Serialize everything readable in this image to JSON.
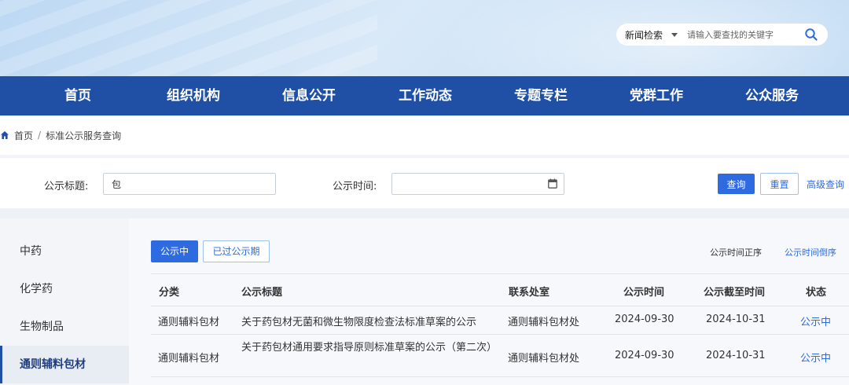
{
  "header": {
    "search": {
      "category": "新闻检索",
      "placeholder": "请输入要查找的关键字"
    }
  },
  "nav": {
    "items": [
      "首页",
      "组织机构",
      "信息公开",
      "工作动态",
      "专题专栏",
      "党群工作",
      "公众服务"
    ]
  },
  "breadcrumb": {
    "home": "首页",
    "separator": "/",
    "current": "标准公示服务查询"
  },
  "filter": {
    "title_label": "公示标题:",
    "title_value": "包",
    "time_label": "公示时间:",
    "time_value": "",
    "query_button": "查询",
    "reset_button": "重置",
    "advanced_link": "高级查询"
  },
  "sidebar": {
    "items": [
      "中药",
      "化学药",
      "生物制品",
      "通则辅料包材"
    ],
    "active_index": 3
  },
  "tabs": {
    "active": "公示中",
    "inactive": "已过公示期"
  },
  "sort": {
    "asc": "公示时间正序",
    "desc": "公示时间倒序"
  },
  "table": {
    "headers": [
      "分类",
      "公示标题",
      "联系处室",
      "公示时间",
      "公示截至时间",
      "状态"
    ],
    "rows": [
      [
        "通则辅料包材",
        "关于药包材无菌和微生物限度检查法标准草案的公示",
        "通则辅料包材处",
        "2024-09-30",
        "2024-10-31",
        "公示中"
      ],
      [
        "通则辅料包材",
        "关于药包材通用要求指导原则标准草案的公示（第二次）",
        "通则辅料包材处",
        "2024-09-30",
        "2024-10-31",
        "公示中"
      ]
    ]
  },
  "colors": {
    "nav_bg": "#1f50a6",
    "accent": "#2f6be0"
  }
}
